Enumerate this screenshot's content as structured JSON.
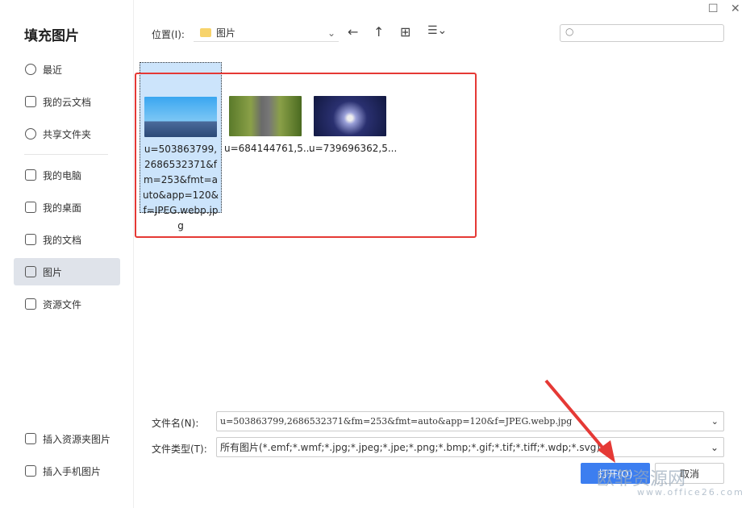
{
  "dialog": {
    "title": "填充图片"
  },
  "sidebar": {
    "items": [
      {
        "label": "最近",
        "icon": "clock-icon"
      },
      {
        "label": "我的云文档",
        "icon": "cloud-doc-icon"
      },
      {
        "label": "共享文件夹",
        "icon": "share-icon"
      },
      {
        "label": "我的电脑",
        "icon": "computer-icon"
      },
      {
        "label": "我的桌面",
        "icon": "desktop-icon"
      },
      {
        "label": "我的文档",
        "icon": "documents-icon"
      },
      {
        "label": "图片",
        "icon": "pictures-icon",
        "active": true
      },
      {
        "label": "资源文件",
        "icon": "folder-icon"
      }
    ],
    "bottom": [
      {
        "label": "插入资源夹图片"
      },
      {
        "label": "插入手机图片"
      }
    ]
  },
  "toolbar": {
    "location_label": "位置(I):",
    "location_value": "图片"
  },
  "files": [
    {
      "name": "u=503863799,2686532371&fm=253&fmt=auto&app=120&f=JPEG.webp.jpg",
      "selected": true
    },
    {
      "name": "u=684144761,5..."
    },
    {
      "name": "u=739696362,5..."
    }
  ],
  "form": {
    "filename_label": "文件名(N):",
    "filename_value": "u=503863799,2686532371&fm=253&fmt=auto&app=120&f=JPEG.webp.jpg",
    "filetype_label": "文件类型(T):",
    "filetype_value": "所有图片(*.emf;*.wmf;*.jpg;*.jpeg;*.jpe;*.png;*.bmp;*.gif;*.tif;*.tiff;*.wdp;*.svg)"
  },
  "buttons": {
    "open": "打开(O)",
    "cancel": "取消"
  },
  "watermark": {
    "text": "欧菲资源网",
    "url": "www.office26.com"
  },
  "colors": {
    "accent": "#3c7ef0",
    "highlight": "#e53935"
  }
}
